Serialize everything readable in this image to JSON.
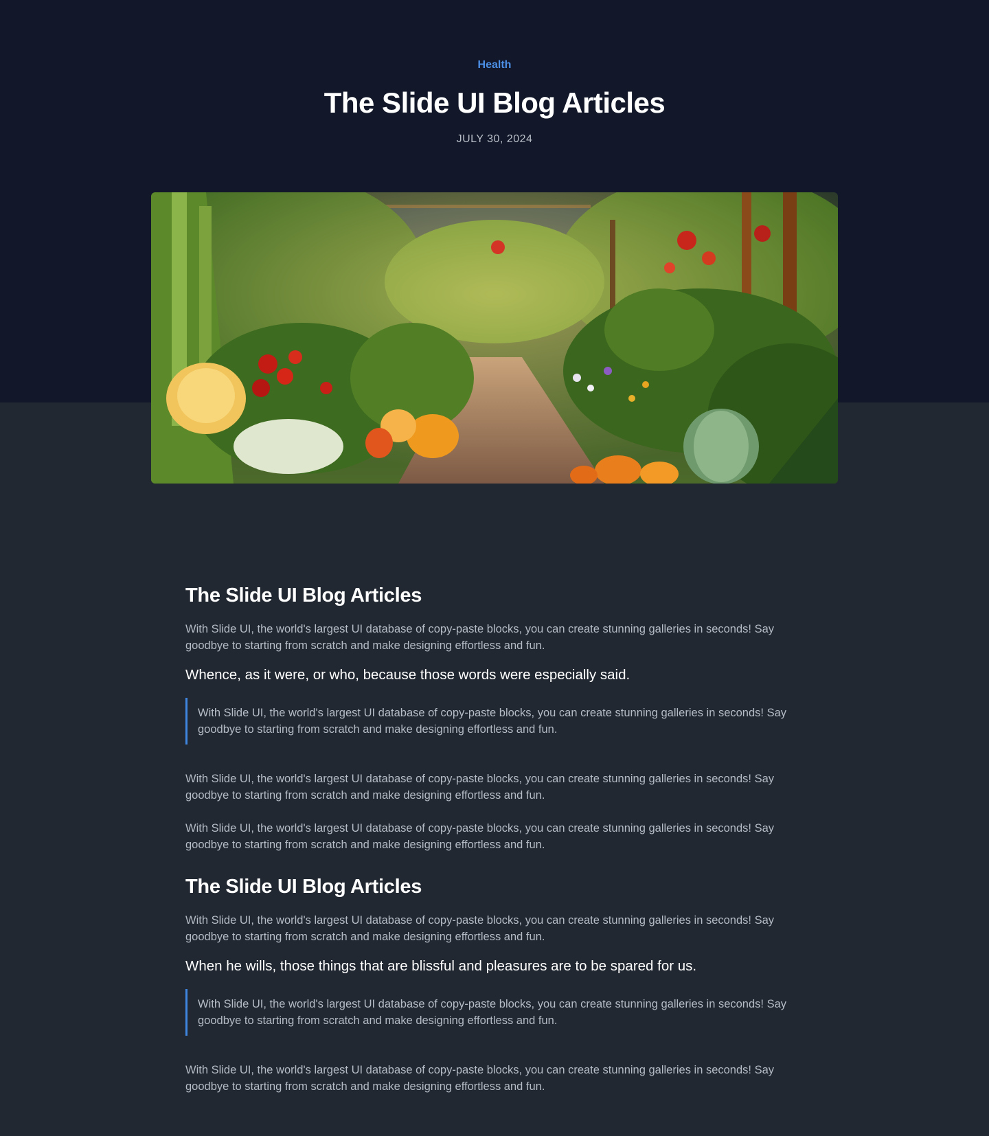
{
  "hero": {
    "category": "Health",
    "title": "The Slide UI Blog Articles",
    "date": "JULY 30, 2024"
  },
  "article": {
    "section1": {
      "heading": "The Slide UI Blog Articles",
      "intro": "With Slide UI, the world's largest UI database of copy-paste blocks, you can create stunning galleries in seconds! Say goodbye to starting from scratch and make designing effortless and fun.",
      "subheading": "Whence, as it were, or who, because those words were especially said.",
      "quote": "With Slide UI, the world's largest UI database of copy-paste blocks, you can create stunning galleries in seconds! Say goodbye to starting from scratch and make designing effortless and fun.",
      "para1": "With Slide UI, the world's largest UI database of copy-paste blocks, you can create stunning galleries in seconds! Say goodbye to starting from scratch and make designing effortless and fun.",
      "para2": "With Slide UI, the world's largest UI database of copy-paste blocks, you can create stunning galleries in seconds! Say goodbye to starting from scratch and make designing effortless and fun."
    },
    "section2": {
      "heading": "The Slide UI Blog Articles",
      "intro": "With Slide UI, the world's largest UI database of copy-paste blocks, you can create stunning galleries in seconds! Say goodbye to starting from scratch and make designing effortless and fun.",
      "subheading": "When he wills, those things that are blissful and pleasures are to be spared for us.",
      "quote": "With Slide UI, the world's largest UI database of copy-paste blocks, you can create stunning galleries in seconds! Say goodbye to starting from scratch and make designing effortless and fun.",
      "para1": "With Slide UI, the world's largest UI database of copy-paste blocks, you can create stunning galleries in seconds! Say goodbye to starting from scratch and make designing effortless and fun."
    }
  },
  "colors": {
    "hero_bg": "#121829",
    "page_bg": "#222831",
    "accent": "#4c8fe6",
    "quote_border": "#3f86e0",
    "body_text": "#b6bcc6",
    "heading_text": "#ffffff"
  }
}
